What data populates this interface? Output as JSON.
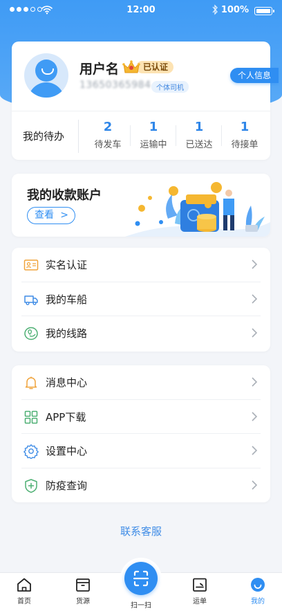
{
  "status_bar": {
    "time": "12:00",
    "battery": "100%"
  },
  "profile": {
    "username": "用户名",
    "verified_badge": "已认证",
    "phone": "13650365984",
    "role_tag": "个体司机",
    "info_button": "个人信息"
  },
  "todo": {
    "label": "我的待办",
    "items": [
      {
        "count": "2",
        "label": "待发车"
      },
      {
        "count": "1",
        "label": "运输中"
      },
      {
        "count": "1",
        "label": "已送达"
      },
      {
        "count": "1",
        "label": "待接单"
      }
    ]
  },
  "account": {
    "title": "我的收款账户",
    "view_button": "查看"
  },
  "menu_group_1": [
    {
      "label": "实名认证",
      "icon": "id-card-icon"
    },
    {
      "label": "我的车船",
      "icon": "truck-icon"
    },
    {
      "label": "我的线路",
      "icon": "route-icon"
    }
  ],
  "menu_group_2": [
    {
      "label": "消息中心",
      "icon": "bell-icon"
    },
    {
      "label": "APP下载",
      "icon": "grid-icon"
    },
    {
      "label": "设置中心",
      "icon": "gear-icon"
    },
    {
      "label": "防疫查询",
      "icon": "shield-plus-icon"
    }
  ],
  "contact_service": "联系客服",
  "tabbar": {
    "home": "首页",
    "cargo": "货源",
    "scan": "扫一扫",
    "waybill": "运单",
    "mine": "我的"
  },
  "colors": {
    "primary": "#2f8ef2",
    "header": "#3f9bf5",
    "badge": "#fde3b3"
  }
}
